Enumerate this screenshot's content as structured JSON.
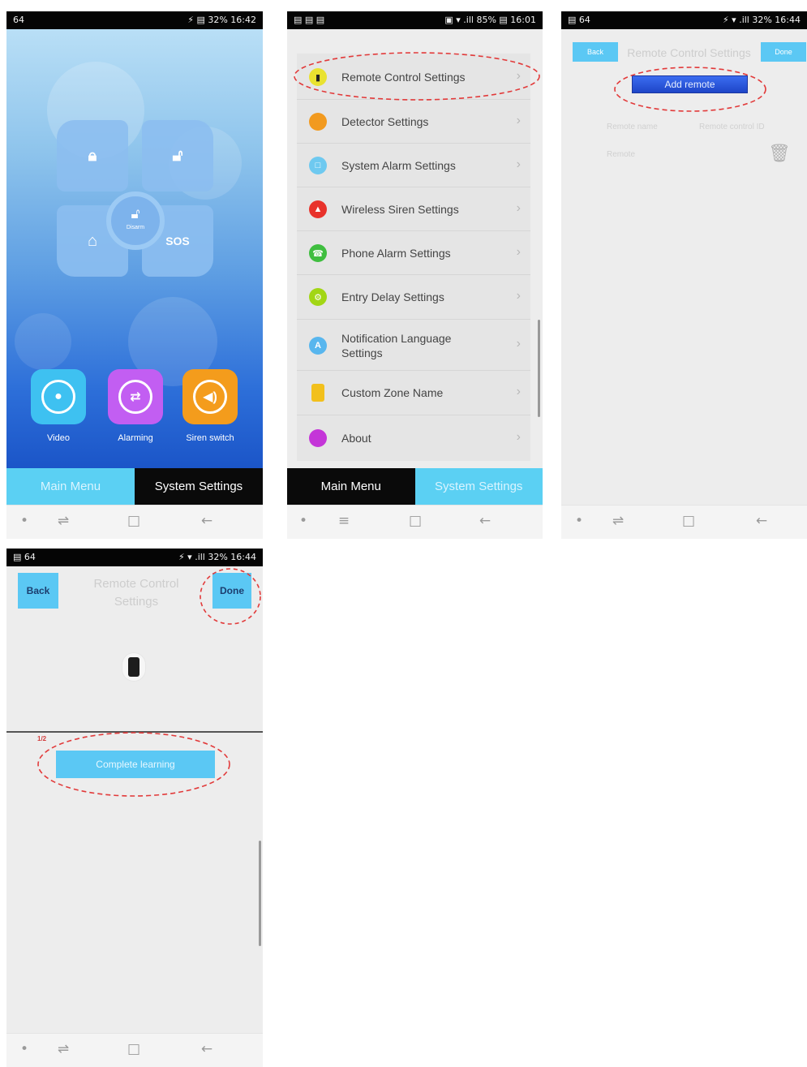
{
  "panel1": {
    "status": {
      "left": "64",
      "right": "⚡ ▤ 32% 16:42"
    },
    "controls": {
      "arm_icon": "lock-icon",
      "disarm_icon": "unlock-icon",
      "home_icon": "home-icon",
      "sos_label": "SOS",
      "center_label": "Disarm"
    },
    "apps": [
      {
        "label": "Video",
        "color": "#3ec1f1"
      },
      {
        "label": "Alarming",
        "color": "#c25ef2"
      },
      {
        "label": "Siren switch",
        "color": "#f49c1c"
      }
    ],
    "tabs": {
      "main": "Main Menu",
      "settings": "System Settings"
    }
  },
  "panel2": {
    "status": {
      "left": "▤ ▤ ▤",
      "right": "▣ ▾ .ill 85% ▤ 16:01"
    },
    "menu": [
      {
        "label": "Remote Control Settings",
        "color": "#e9e230"
      },
      {
        "label": "Detector Settings",
        "color": "#f29a1f"
      },
      {
        "label": "System Alarm Settings",
        "color": "#6ec9f0"
      },
      {
        "label": "Wireless Siren Settings",
        "color": "#e8322b"
      },
      {
        "label": "Phone Alarm Settings",
        "color": "#3fbe3f"
      },
      {
        "label": "Entry Delay Settings",
        "color": "#a2d614"
      },
      {
        "label": "Notification Language Settings",
        "color": "#58b6ee"
      },
      {
        "label": "Custom Zone Name",
        "color": "#f2c01c"
      },
      {
        "label": "About",
        "color": "#c435d8"
      }
    ],
    "tabs": {
      "main": "Main Menu",
      "settings": "System Settings"
    }
  },
  "panel3": {
    "status": {
      "left": "▤ 64",
      "right": "⚡ ▾ .ill 32% 16:44"
    },
    "back": "Back",
    "title": "Remote Control Settings",
    "done": "Done",
    "add_button": "Add remote",
    "col1": "Remote name",
    "col2": "Remote control ID",
    "row_value": "Remote"
  },
  "panel4": {
    "status": {
      "left": "▤ 64",
      "right": "⚡ ▾ .ill 32% 16:44"
    },
    "back": "Back",
    "title": "Remote Control Settings",
    "done": "Done",
    "complete_button": "Complete learning",
    "marker": "1/2"
  }
}
